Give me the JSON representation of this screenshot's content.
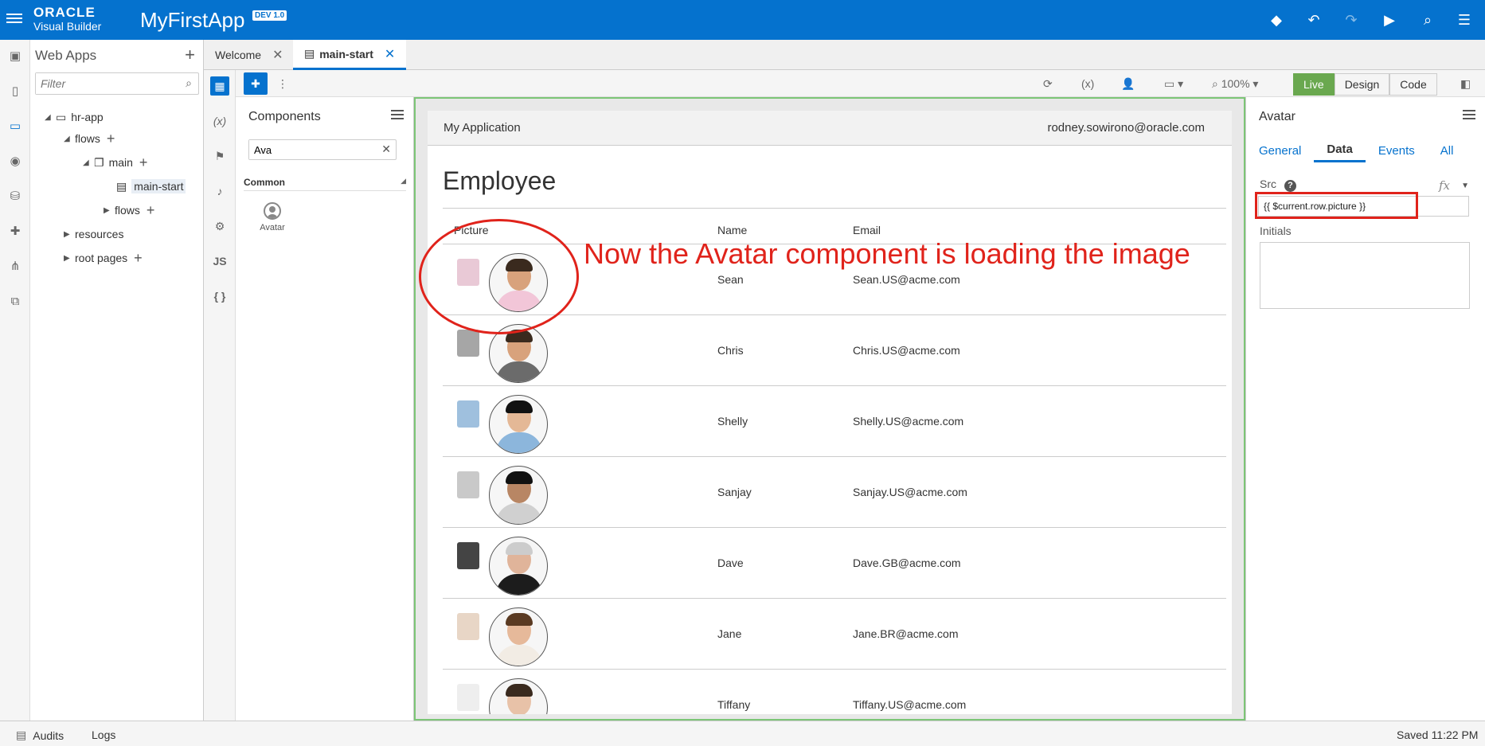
{
  "topbar": {
    "brand_line1": "ORACLE",
    "brand_line2": "Visual Builder",
    "app_name": "MyFirstApp",
    "version_badge": "DEV 1.0",
    "brand_color": "#0572ce"
  },
  "navigator": {
    "title": "Web Apps",
    "filter_placeholder": "Filter",
    "tree": [
      {
        "label": "hr-app"
      },
      {
        "label": "flows"
      },
      {
        "label": "main"
      },
      {
        "label": "main-start"
      },
      {
        "label": "flows"
      },
      {
        "label": "resources"
      },
      {
        "label": "root pages"
      }
    ]
  },
  "tabs": [
    {
      "label": "Welcome"
    },
    {
      "label": "main-start"
    }
  ],
  "components": {
    "title": "Components",
    "search_value": "Ava",
    "section": "Common",
    "item": "Avatar"
  },
  "toolbar": {
    "zoom": "100%",
    "modes": [
      "Live",
      "Design",
      "Code"
    ]
  },
  "page": {
    "app_title": "My Application",
    "user_email": "rodney.sowirono@oracle.com",
    "heading": "Employee",
    "columns": [
      "Picture",
      "Name",
      "Email"
    ],
    "rows": [
      {
        "name": "Sean",
        "email": "Sean.US@acme.com"
      },
      {
        "name": "Chris",
        "email": "Chris.US@acme.com"
      },
      {
        "name": "Shelly",
        "email": "Shelly.US@acme.com"
      },
      {
        "name": "Sanjay",
        "email": "Sanjay.US@acme.com"
      },
      {
        "name": "Dave",
        "email": "Dave.GB@acme.com"
      },
      {
        "name": "Jane",
        "email": "Jane.BR@acme.com"
      },
      {
        "name": "Tiffany",
        "email": "Tiffany.US@acme.com"
      }
    ]
  },
  "annotation": {
    "text": "Now the Avatar component is loading the image",
    "color": "#e0231b"
  },
  "properties": {
    "title": "Avatar",
    "tabs": [
      "General",
      "Data",
      "Events",
      "All"
    ],
    "src_label": "Src",
    "src_value": "{{ $current.row.picture }}",
    "initials_label": "Initials"
  },
  "statusbar": {
    "audits": "Audits",
    "logs": "Logs",
    "saved": "Saved 11:22 PM"
  }
}
